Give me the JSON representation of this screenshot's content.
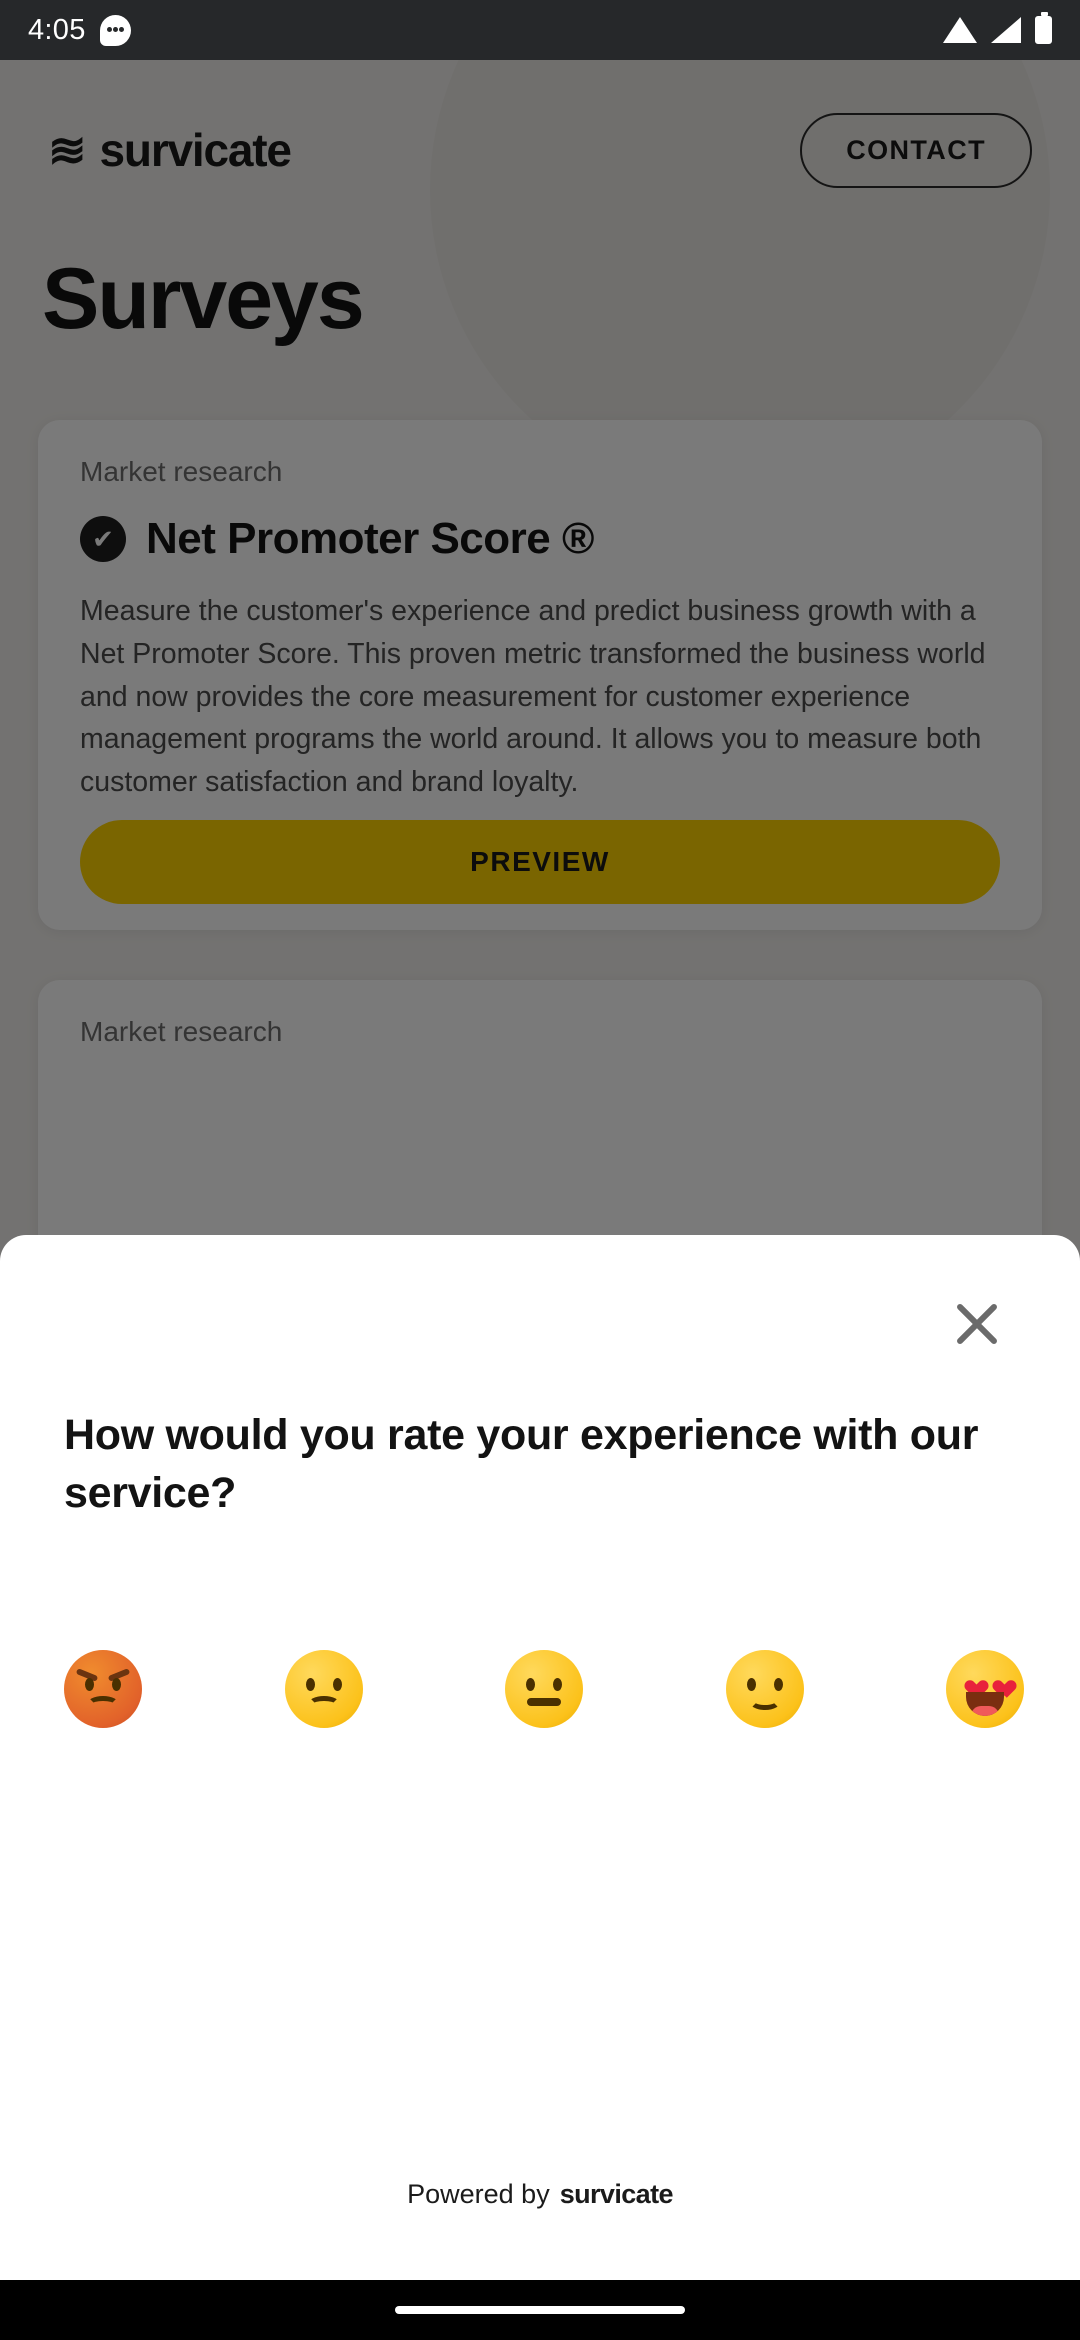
{
  "status_bar": {
    "clock": "4:05",
    "icons": [
      "message-icon",
      "wifi-icon",
      "signal-icon",
      "battery-icon"
    ]
  },
  "background_page": {
    "brand_mark": "≋",
    "brand_name": "survicate",
    "contact_button": "CONTACT",
    "page_title": "Surveys",
    "cards": [
      {
        "kicker": "Market research",
        "title": "Net Promoter Score ®",
        "body": "Measure the customer's experience and predict business growth with a Net Promoter Score. This proven metric transformed the business world and now provides the core measurement for customer experience management programs the world around. It allows you to measure both customer satisfaction and brand loyalty.",
        "button": "PREVIEW",
        "check_glyph": "✔"
      },
      {
        "kicker": "Market research",
        "title": "",
        "body": "",
        "button": "",
        "check_glyph": ""
      }
    ]
  },
  "survey": {
    "close_label": "Close",
    "question": "How would you rate your experience with our service?",
    "options": [
      {
        "name": "rating-angry",
        "label": "Very dissatisfied",
        "value": 1
      },
      {
        "name": "rating-sad",
        "label": "Dissatisfied",
        "value": 2
      },
      {
        "name": "rating-neutral",
        "label": "Neutral",
        "value": 3
      },
      {
        "name": "rating-happy",
        "label": "Satisfied",
        "value": 4
      },
      {
        "name": "rating-love",
        "label": "Very satisfied",
        "value": 5
      }
    ],
    "powered_by_prefix": "Powered by",
    "powered_by_brand": "survicate"
  },
  "colors": {
    "accent_yellow": "#ffd400",
    "sheet_background": "#ffffff",
    "scrim": "rgba(0,0,0,0.52)",
    "status_bar": "#26282a",
    "nav_bar": "#000000"
  }
}
